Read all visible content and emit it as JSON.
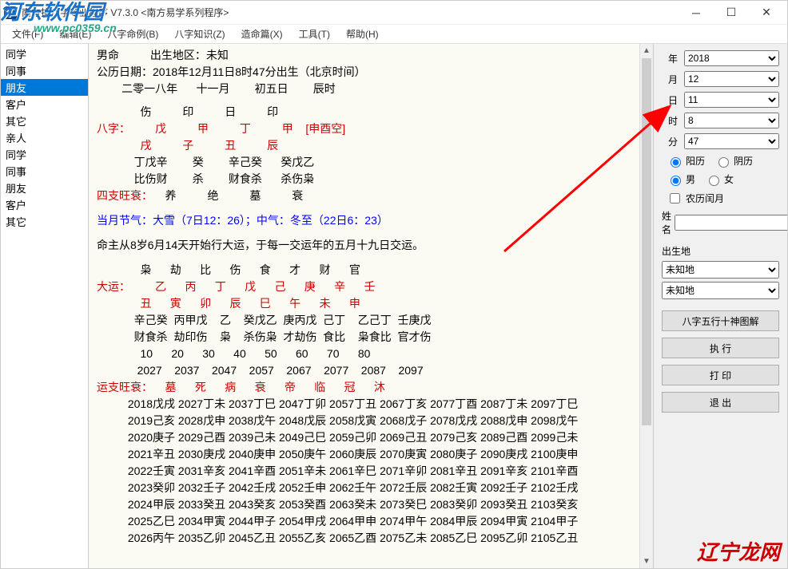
{
  "window_title": "南方排八字专业程序 V7.3.0   <南方易学系列程序>",
  "menu": [
    "文件(F)",
    "编辑(E)",
    "八字命例(B)",
    "八字知识(Z)",
    "造命篇(X)",
    "工具(T)",
    "帮助(H)"
  ],
  "sidebar": {
    "items": [
      "同学",
      "同事",
      "朋友",
      "客户",
      "其它",
      "亲人",
      "同学",
      "同事",
      "朋友",
      "客户",
      "其它"
    ],
    "selected_index": 2
  },
  "content": {
    "header1_a": "男命",
    "header1_b": "出生地区：未知",
    "header2": "公历日期：2018年12月11日8时47分出生（北京时间）",
    "header3": "        二零一八年      十一月        初五日        辰时",
    "row_roles": "              伤          印          日          印",
    "bazi_label": "八字：",
    "bazi_top": "        戊          甲          丁          甲",
    "bazi_space": "    [申酉空]",
    "bazi_bot": "              戌          子          丑          辰",
    "row_hidden": "            丁戊辛        癸        辛己癸      癸戊乙",
    "row_hidden2": "            比伤财        杀        财食杀      杀伤枭",
    "sizhi_label": "四支旺衰：",
    "sizhi": "    养          绝          墓          衰",
    "jieqi_label": "当月节气：",
    "jieqi": "大雪（7日12：26）；中气：冬至（22日6：23）",
    "cmd": "命主从8岁6月14天开始行大运，于每一交运年的五月十九日交运。",
    "dy_roles": "              枭      劫      比      伤      食      才      财      官",
    "dy_label": "大运：",
    "dy_top": "        乙      丙      丁      戊      己      庚      辛      壬",
    "dy_bot": "              丑      寅      卯      辰      巳      午      未      申",
    "dy_h1": "            辛己癸  丙甲戊    乙    癸戊乙  庚丙戊  己丁    乙己丁  壬庚戊",
    "dy_h2": "            财食杀  劫印伤    枭    杀伤枭  才劫伤  食比    枭食比  官才伤",
    "dy_ages": "              10      20      30      40      50      60      70      80  ",
    "dy_years": "             2027    2037    2047    2057    2067    2077    2087    2097 ",
    "yz_label": "运支旺衰：",
    "yz": "    墓      死      病      衰      帝      临      冠      沐",
    "ln": [
      "          2018戊戌 2027丁未 2037丁巳 2047丁卯 2057丁丑 2067丁亥 2077丁酉 2087丁未 2097丁巳",
      "          2019己亥 2028戊申 2038戊午 2048戊辰 2058戊寅 2068戊子 2078戊戌 2088戊申 2098戊午",
      "          2020庚子 2029己酉 2039己未 2049己巳 2059己卯 2069己丑 2079己亥 2089己酉 2099己未",
      "          2021辛丑 2030庚戌 2040庚申 2050庚午 2060庚辰 2070庚寅 2080庚子 2090庚戌 2100庚申",
      "          2022壬寅 2031辛亥 2041辛酉 2051辛未 2061辛巳 2071辛卯 2081辛丑 2091辛亥 2101辛酉",
      "          2023癸卯 2032壬子 2042壬戌 2052壬申 2062壬午 2072壬辰 2082壬寅 2092壬子 2102壬戌",
      "          2024甲辰 2033癸丑 2043癸亥 2053癸酉 2063癸未 2073癸巳 2083癸卯 2093癸丑 2103癸亥",
      "          2025乙巳 2034甲寅 2044甲子 2054甲戌 2064甲申 2074甲午 2084甲辰 2094甲寅 2104甲子",
      "          2026丙午 2035乙卯 2045乙丑 2055乙亥 2065乙酉 2075乙未 2085乙巳 2095乙卯 2105乙丑"
    ]
  },
  "right": {
    "year_label": "年",
    "year": "2018",
    "month_label": "月",
    "month": "12",
    "day_label": "日",
    "day": "11",
    "hour_label": "时",
    "hour": "8",
    "min_label": "分",
    "min": "47",
    "cal_solar": "阳历",
    "cal_lunar": "阴历",
    "sex_m": "男",
    "sex_f": "女",
    "leap": "农历闰月",
    "name_label": "姓名",
    "name_value": "",
    "birthplace_label": "出生地",
    "place1": "未知地",
    "place2": "未知地",
    "btn1": "八字五行十神图解",
    "btn2": "执 行",
    "btn3": "打 印",
    "btn4": "退 出"
  },
  "watermark_top": "河东软件园",
  "watermark_top_sub": "www.pc0359.cn",
  "watermark_br": "辽宁龙网"
}
